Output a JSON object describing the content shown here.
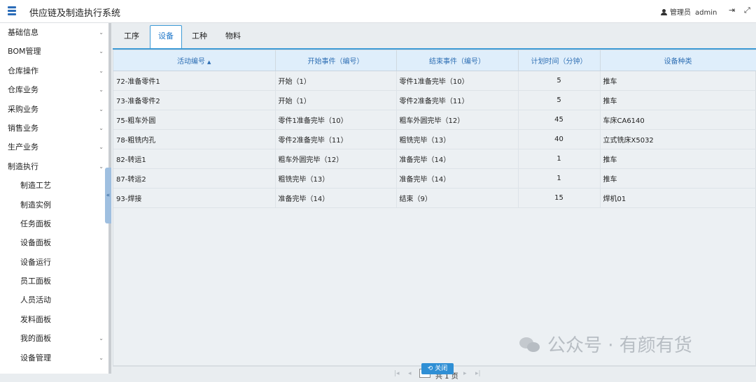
{
  "app": {
    "title": "供应链及制造执行系统"
  },
  "header": {
    "user_role": "管理员",
    "user_name": "admin",
    "icons": {
      "menu": "hamburger-icon",
      "user": "user-icon",
      "logout": "logout-icon",
      "fullscreen": "fullscreen-icon"
    }
  },
  "sidebar": {
    "items": [
      {
        "label": "基础信息",
        "level": 1,
        "expandable": true
      },
      {
        "label": "BOM管理",
        "level": 1,
        "expandable": true
      },
      {
        "label": "仓库操作",
        "level": 1,
        "expandable": true
      },
      {
        "label": "仓库业务",
        "level": 1,
        "expandable": true
      },
      {
        "label": "采购业务",
        "level": 1,
        "expandable": true
      },
      {
        "label": "销售业务",
        "level": 1,
        "expandable": true
      },
      {
        "label": "生产业务",
        "level": 1,
        "expandable": true
      },
      {
        "label": "制造执行",
        "level": 1,
        "expandable": true,
        "expanded": true
      },
      {
        "label": "制造工艺",
        "level": 2,
        "expandable": false
      },
      {
        "label": "制造实例",
        "level": 2,
        "expandable": false
      },
      {
        "label": "任务面板",
        "level": 2,
        "expandable": false
      },
      {
        "label": "设备面板",
        "level": 2,
        "expandable": false
      },
      {
        "label": "设备运行",
        "level": 2,
        "expandable": false
      },
      {
        "label": "员工面板",
        "level": 2,
        "expandable": false
      },
      {
        "label": "人员活动",
        "level": 2,
        "expandable": false
      },
      {
        "label": "发料面板",
        "level": 2,
        "expandable": false
      },
      {
        "label": "我的面板",
        "level": 2,
        "expandable": true
      },
      {
        "label": "设备管理",
        "level": 2,
        "expandable": true
      }
    ],
    "collapse_glyph": "«"
  },
  "tabs": [
    {
      "label": "工序",
      "active": false
    },
    {
      "label": "设备",
      "active": true
    },
    {
      "label": "工种",
      "active": false
    },
    {
      "label": "物料",
      "active": false
    }
  ],
  "table": {
    "columns": [
      "活动编号",
      "开始事件（编号）",
      "结束事件（编号）",
      "计划时间（分钟）",
      "设备种类"
    ],
    "sorted_column": 0,
    "sort_glyph": "▲",
    "rows": [
      [
        "72-准备零件1",
        "开始（1）",
        "零件1准备完毕（10）",
        "5",
        "推车"
      ],
      [
        "73-准备零件2",
        "开始（1）",
        "零件2准备完毕（11）",
        "5",
        "推车"
      ],
      [
        "75-粗车外圆",
        "零件1准备完毕（10）",
        "粗车外圆完毕（12）",
        "45",
        "车床CA6140"
      ],
      [
        "78-粗铣内孔",
        "零件2准备完毕（11）",
        "粗铣完毕（13）",
        "40",
        "立式铣床X5032"
      ],
      [
        "82-转运1",
        "粗车外圆完毕（12）",
        "准备完毕（14）",
        "1",
        "推车"
      ],
      [
        "87-转运2",
        "粗铣完毕（13）",
        "准备完毕（14）",
        "1",
        "推车"
      ],
      [
        "93-焊接",
        "准备完毕（14）",
        "结束（9）",
        "15",
        "焊机01"
      ]
    ]
  },
  "pager": {
    "current_page": "1",
    "total_text": "共 1 页",
    "first_glyph": "|◂",
    "prev_glyph": "◂",
    "next_glyph": "▸",
    "last_glyph": "▸|"
  },
  "close_button": {
    "label": "关闭",
    "glyph": "⟲"
  },
  "watermark": {
    "text": "公众号 · 有颜有货"
  },
  "colors": {
    "accent": "#3c9ad6",
    "header_text": "#2e6fb4",
    "button": "#2f8fd5"
  }
}
